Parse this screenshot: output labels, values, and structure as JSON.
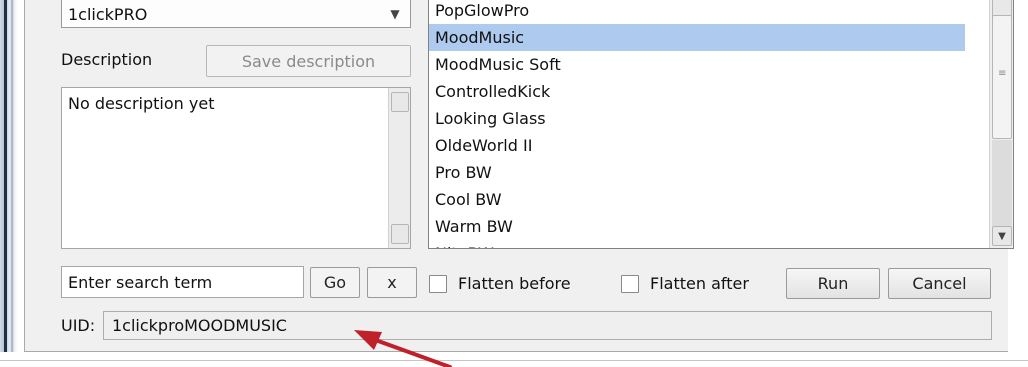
{
  "template": {
    "selected": "1clickPRO"
  },
  "description": {
    "label": "Description",
    "save_button": "Save description",
    "text": "No description yet"
  },
  "presets": {
    "items": [
      "PopGlowPro",
      "MoodMusic",
      "MoodMusic Soft",
      "ControlledKick",
      "Looking Glass",
      "OldeWorld II",
      "Pro BW",
      "Cool BW",
      "Warm BW",
      "NiteBW"
    ],
    "selected": "MoodMusic"
  },
  "search": {
    "placeholder": "Enter search term",
    "go_label": "Go",
    "clear_label": "x"
  },
  "options": {
    "flatten_before": "Flatten before",
    "flatten_after": "Flatten after"
  },
  "actions": {
    "run_label": "Run",
    "cancel_label": "Cancel"
  },
  "uid": {
    "label": "UID:",
    "value": "1clickproMOODMUSIC"
  },
  "annotation": {
    "arrow_color": "#c0202a"
  },
  "colors": {
    "selection": "#aecaee",
    "panel_bg": "#f0f0f0"
  }
}
